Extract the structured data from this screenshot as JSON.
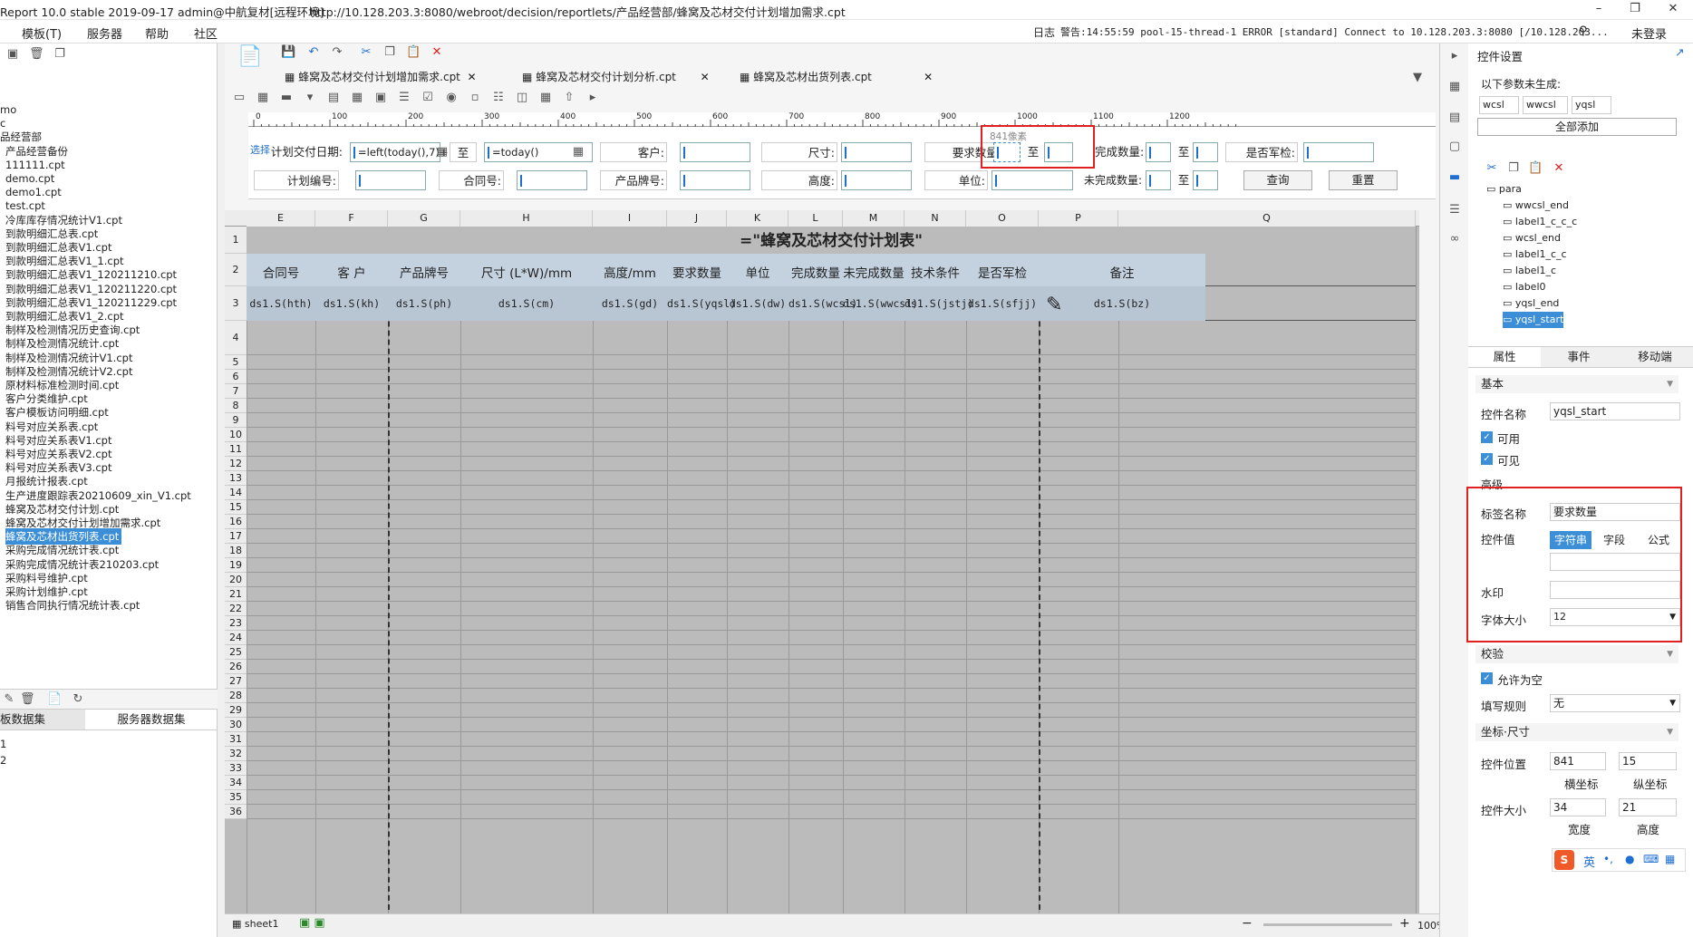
{
  "window": {
    "title": "Report 10.0 stable 2019-09-17 admin@中航复材[远程环境]",
    "url": "http://10.128.203.3:8080/webroot/decision/reportlets/产品经营部/蜂窝及芯材交付计划增加需求.cpt"
  },
  "menu": [
    "模板(T)",
    "服务器",
    "帮助",
    "社区"
  ],
  "log": {
    "label": "日志",
    "text": "警告:14:55:59 pool-15-thread-1 ERROR [standard] Connect to 10.128.203.3:8080 [/10.128.203...",
    "login": "未登录"
  },
  "left_tree": {
    "items": [
      "mo",
      "c",
      "品经营部",
      "产品经营备份",
      "111111.cpt",
      "demo.cpt",
      "demo1.cpt",
      "test.cpt",
      "冷库库存情况统计V1.cpt",
      "到款明细汇总表.cpt",
      "到款明细汇总表V1.cpt",
      "到款明细汇总表V1_1.cpt",
      "到款明细汇总表V1_120211210.cpt",
      "到款明细汇总表V1_120211220.cpt",
      "到款明细汇总表V1_120211229.cpt",
      "到款明细汇总表V1_2.cpt",
      "制样及检测情况历史查询.cpt",
      "制样及检测情况统计.cpt",
      "制样及检测情况统计V1.cpt",
      "制样及检测情况统计V2.cpt",
      "原材料标准检测时间.cpt",
      "客户分类维护.cpt",
      "客户模板访问明细.cpt",
      "料号对应关系表.cpt",
      "料号对应关系表V1.cpt",
      "料号对应关系表V2.cpt",
      "料号对应关系表V3.cpt",
      "月报统计报表.cpt",
      "生产进度跟踪表20210609_xin_V1.cpt",
      "蜂窝及芯材交付计划.cpt",
      "蜂窝及芯材交付计划增加需求.cpt",
      "蜂窝及芯材出货列表.cpt",
      "采购完成情况统计表.cpt",
      "采购完成情况统计表210203.cpt",
      "采购料号维护.cpt",
      "采购计划维护.cpt",
      "销售合同执行情况统计表.cpt"
    ],
    "selected": "蜂窝及芯材出货列表.cpt"
  },
  "dataset": {
    "tabs": [
      "板数据集",
      "服务器数据集"
    ],
    "items": [
      "1",
      "2"
    ]
  },
  "tabs": [
    "蜂窝及芯材交付计划增加需求.cpt",
    "蜂窝及芯材交付计划分析.cpt",
    "蜂窝及芯材出货列表.cpt"
  ],
  "ruler": [
    "0",
    "100",
    "200",
    "300",
    "400",
    "500",
    "600",
    "700",
    "800",
    "900",
    "1000",
    "1100",
    "1200"
  ],
  "params": {
    "row1": [
      {
        "label": "计划交付日期:",
        "v1": "=left(today(),7)+",
        "to": "至",
        "v2": "=today()"
      },
      {
        "label": "客户:"
      },
      {
        "label": "尺寸:"
      },
      {
        "label": "要求数量:",
        "to": "至"
      },
      {
        "label": "完成数量:",
        "to": "至"
      },
      {
        "label": "是否军检:"
      }
    ],
    "row2": [
      {
        "label": "计划编号:"
      },
      {
        "label": "合同号:"
      },
      {
        "label": "产品牌号:"
      },
      {
        "label": "高度:"
      },
      {
        "label": "单位:"
      },
      {
        "label": "未完成数量:",
        "to": "至"
      }
    ],
    "query": "查询",
    "reset": "重置",
    "watermark": "841像素",
    "tag": "选择"
  },
  "sheet": {
    "columns": [
      "E",
      "F",
      "G",
      "H",
      "I",
      "J",
      "K",
      "L",
      "M",
      "N",
      "O",
      "P",
      "Q"
    ],
    "title": "=\"蜂窝及芯材交付计划表\"",
    "headers": [
      "合同号",
      "客 户",
      "产品牌号",
      "尺寸 (L*W)/mm",
      "高度/mm",
      "要求数量",
      "单位",
      "完成数量",
      "未完成数量",
      "技术条件",
      "是否军检",
      "备注"
    ],
    "cells": [
      "ds1.S(hth)",
      "ds1.S(kh)",
      "ds1.S(ph)",
      "ds1.S(cm)",
      "ds1.S(gd)",
      "ds1.S(yqsl)",
      "ds1.S(dw)",
      "ds1.S(wcsl)",
      "ds1.S(wwcsl)",
      "ds1.S(jstj)",
      "ds1.S(sfjj)",
      "ds1.S(bz)"
    ],
    "rows": [
      "1",
      "2",
      "3",
      "4",
      "5",
      "6",
      "7",
      "8",
      "9",
      "10",
      "11",
      "12",
      "13",
      "14",
      "15",
      "16",
      "17",
      "18",
      "19",
      "20",
      "21",
      "22",
      "23",
      "24",
      "25",
      "26",
      "27",
      "28",
      "29",
      "30",
      "31",
      "32",
      "33",
      "34",
      "35",
      "36"
    ],
    "sheet_name": "sheet1",
    "zoom": "100%"
  },
  "right": {
    "title": "控件设置",
    "ungenerated_label": "以下参数未生成:",
    "ungenerated": [
      "wcsl",
      "wwcsl",
      "yqsl"
    ],
    "add_all": "全部添加",
    "tree": [
      "para",
      "wwcsl_end",
      "label1_c_c_c",
      "wcsl_end",
      "label1_c_c",
      "label1_c",
      "label0",
      "yqsl_end",
      "yqsl_start"
    ],
    "tree_selected": "yqsl_start",
    "tabs": [
      "属性",
      "事件",
      "移动端"
    ],
    "basic": "基本",
    "name_label": "控件名称",
    "name_value": "yqsl_start",
    "enabled": "可用",
    "visible": "可见",
    "advanced": "高级",
    "label_name": "标签名称",
    "label_value": "要求数量",
    "value_label": "控件值",
    "value_modes": [
      "字符串",
      "字段",
      "公式"
    ],
    "watermark": "水印",
    "fontsize_label": "字体大小",
    "fontsize": "12",
    "validate": "校验",
    "allow_empty": "允许为空",
    "rule_label": "填写规则",
    "rule_value": "无",
    "coord": "坐标·尺寸",
    "pos_label": "控件位置",
    "x": "841",
    "y": "15",
    "x_cap": "横坐标",
    "y_cap": "纵坐标",
    "size_label": "控件大小",
    "w": "34",
    "h": "21",
    "w_cap": "宽度",
    "h_cap": "高度",
    "ime": "英"
  }
}
